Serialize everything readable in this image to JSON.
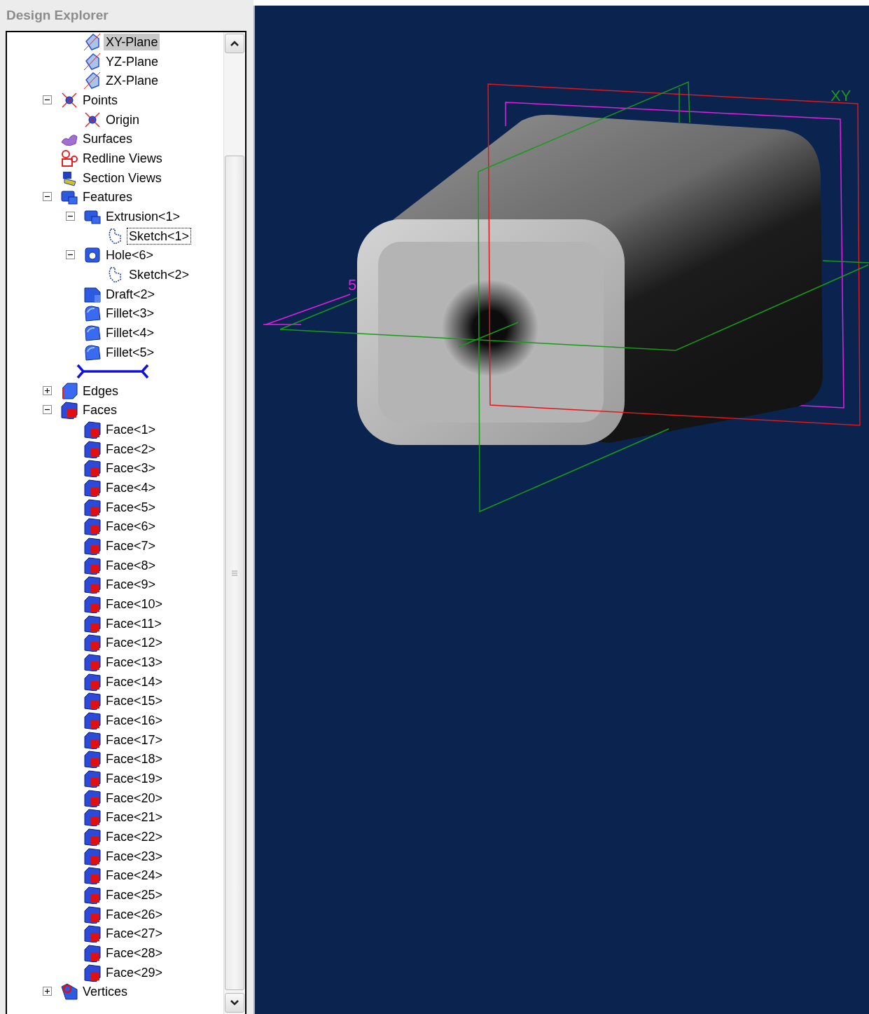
{
  "panel": {
    "title": "Design Explorer"
  },
  "tree": {
    "clipped_branch": [
      {
        "label": "XY-Plane",
        "kind": "plane",
        "selected": true,
        "focused": false
      },
      {
        "label": "YZ-Plane",
        "kind": "plane",
        "selected": false,
        "focused": false
      },
      {
        "label": "ZX-Plane",
        "kind": "plane",
        "selected": false,
        "focused": false
      }
    ],
    "items": [
      {
        "label": "Points",
        "kind": "point",
        "expanded": true,
        "selected": false,
        "focused": false,
        "children": [
          {
            "label": "Origin",
            "kind": "point",
            "selected": false,
            "focused": false
          }
        ]
      },
      {
        "label": "Surfaces",
        "kind": "surfaces",
        "selected": false,
        "focused": false
      },
      {
        "label": "Redline Views",
        "kind": "redline",
        "selected": false,
        "focused": false
      },
      {
        "label": "Section Views",
        "kind": "section",
        "selected": false,
        "focused": false
      },
      {
        "label": "Features",
        "kind": "features",
        "expanded": true,
        "selected": false,
        "focused": false,
        "children": [
          {
            "label": "Extrusion<1>",
            "kind": "extrusion",
            "expanded": true,
            "selected": false,
            "focused": false,
            "children": [
              {
                "label": "Sketch<1>",
                "kind": "sketch",
                "selected": false,
                "focused": true
              }
            ]
          },
          {
            "label": "Hole<6>",
            "kind": "hole",
            "expanded": true,
            "selected": false,
            "focused": false,
            "children": [
              {
                "label": "Sketch<2>",
                "kind": "sketch",
                "selected": false,
                "focused": false
              }
            ]
          },
          {
            "label": "Draft<2>",
            "kind": "draft",
            "selected": false,
            "focused": false
          },
          {
            "label": "Fillet<3>",
            "kind": "fillet",
            "selected": false,
            "focused": false
          },
          {
            "label": "Fillet<4>",
            "kind": "fillet",
            "selected": false,
            "focused": false
          },
          {
            "label": "Fillet<5>",
            "kind": "fillet",
            "selected": false,
            "focused": false
          },
          {
            "kind": "end_marker"
          }
        ]
      },
      {
        "label": "Edges",
        "kind": "edges",
        "expanded": false,
        "selected": false,
        "focused": false
      },
      {
        "label": "Faces",
        "kind": "face",
        "expanded": true,
        "selected": false,
        "focused": false,
        "children": [
          {
            "label": "Face<1>",
            "kind": "face",
            "selected": false,
            "focused": false
          },
          {
            "label": "Face<2>",
            "kind": "face",
            "selected": false,
            "focused": false
          },
          {
            "label": "Face<3>",
            "kind": "face",
            "selected": false,
            "focused": false
          },
          {
            "label": "Face<4>",
            "kind": "face",
            "selected": false,
            "focused": false
          },
          {
            "label": "Face<5>",
            "kind": "face",
            "selected": false,
            "focused": false
          },
          {
            "label": "Face<6>",
            "kind": "face",
            "selected": false,
            "focused": false
          },
          {
            "label": "Face<7>",
            "kind": "face",
            "selected": false,
            "focused": false
          },
          {
            "label": "Face<8>",
            "kind": "face",
            "selected": false,
            "focused": false
          },
          {
            "label": "Face<9>",
            "kind": "face",
            "selected": false,
            "focused": false
          },
          {
            "label": "Face<10>",
            "kind": "face",
            "selected": false,
            "focused": false
          },
          {
            "label": "Face<11>",
            "kind": "face",
            "selected": false,
            "focused": false
          },
          {
            "label": "Face<12>",
            "kind": "face",
            "selected": false,
            "focused": false
          },
          {
            "label": "Face<13>",
            "kind": "face",
            "selected": false,
            "focused": false
          },
          {
            "label": "Face<14>",
            "kind": "face",
            "selected": false,
            "focused": false
          },
          {
            "label": "Face<15>",
            "kind": "face",
            "selected": false,
            "focused": false
          },
          {
            "label": "Face<16>",
            "kind": "face",
            "selected": false,
            "focused": false
          },
          {
            "label": "Face<17>",
            "kind": "face",
            "selected": false,
            "focused": false
          },
          {
            "label": "Face<18>",
            "kind": "face",
            "selected": false,
            "focused": false
          },
          {
            "label": "Face<19>",
            "kind": "face",
            "selected": false,
            "focused": false
          },
          {
            "label": "Face<20>",
            "kind": "face",
            "selected": false,
            "focused": false
          },
          {
            "label": "Face<21>",
            "kind": "face",
            "selected": false,
            "focused": false
          },
          {
            "label": "Face<22>",
            "kind": "face",
            "selected": false,
            "focused": false
          },
          {
            "label": "Face<23>",
            "kind": "face",
            "selected": false,
            "focused": false
          },
          {
            "label": "Face<24>",
            "kind": "face",
            "selected": false,
            "focused": false
          },
          {
            "label": "Face<25>",
            "kind": "face",
            "selected": false,
            "focused": false
          },
          {
            "label": "Face<26>",
            "kind": "face",
            "selected": false,
            "focused": false
          },
          {
            "label": "Face<27>",
            "kind": "face",
            "selected": false,
            "focused": false
          },
          {
            "label": "Face<28>",
            "kind": "face",
            "selected": false,
            "focused": false
          },
          {
            "label": "Face<29>",
            "kind": "face",
            "selected": false,
            "focused": false
          }
        ]
      },
      {
        "label": "Vertices",
        "kind": "vertices",
        "expanded": false,
        "selected": false,
        "focused": false
      }
    ]
  },
  "viewport": {
    "labels": [
      {
        "text": "XY",
        "kind": "plane"
      },
      {
        "text": "5",
        "kind": "dimension"
      }
    ]
  }
}
